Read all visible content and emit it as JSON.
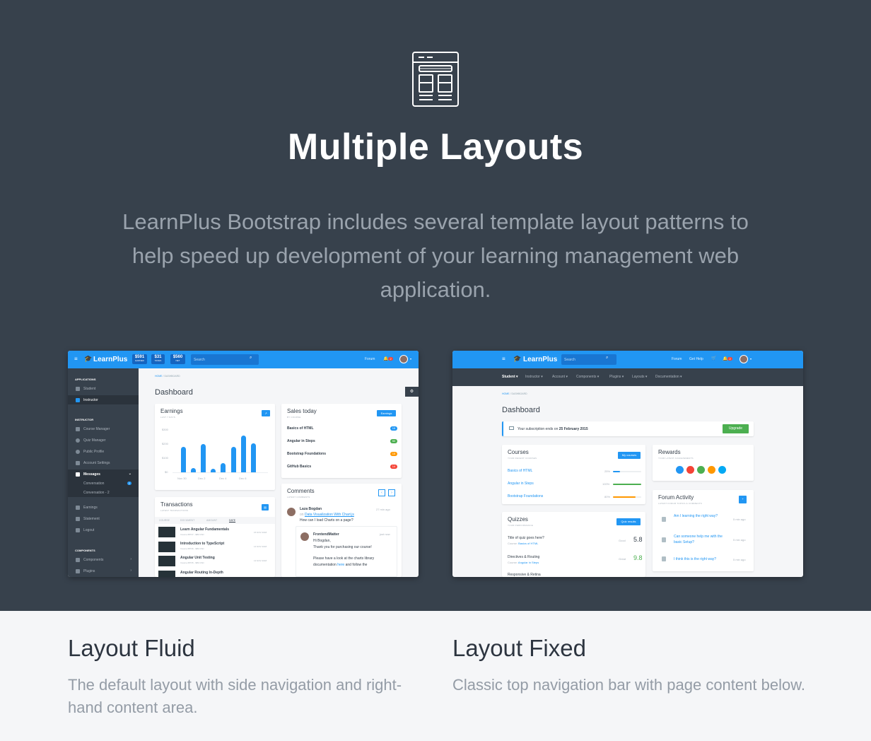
{
  "hero": {
    "icon": "layout-template-icon",
    "title": "Multiple Layouts",
    "description": "LearnPlus Bootstrap includes several template layout patterns to help speed up development of your learning management web application."
  },
  "colors": {
    "hero_bg": "#37414c",
    "accent": "#2196f3",
    "success": "#4caf50",
    "warning": "#ff9800",
    "danger": "#f44336"
  },
  "fluid": {
    "brand": "LearnPlus",
    "stats": [
      {
        "value": "$591",
        "label": "EARNED"
      },
      {
        "value": "$31",
        "label": "TAXES"
      },
      {
        "value": "$560",
        "label": "NET"
      }
    ],
    "search_placeholder": "Search",
    "forum": "Forum",
    "notif_count": "2",
    "sidebar": {
      "applications": "APPLICATIONS",
      "student": "Student",
      "instructor_item": "Instructor",
      "instructor_head": "INSTRUCTOR",
      "course_manager": "Course Manager",
      "quiz_manager": "Quiz Manager",
      "public_profile": "Public Profile",
      "account_settings": "Account Settings",
      "messages": "Messages",
      "conversation": "Conversation",
      "conversation_badge": "2",
      "conversation2": "Conversation - 2",
      "earnings": "Earnings",
      "statement": "Statement",
      "logout": "Logout",
      "components_head": "COMPONENTS",
      "components": "Components",
      "plugins": "Plugins"
    },
    "breadcrumb": {
      "home": "HOME",
      "sep": "/",
      "current": "DASHBOARD"
    },
    "page_title": "Dashboard",
    "earnings": {
      "title": "Earnings",
      "subtitle": "LAST 7 DAYS",
      "y_ticks": [
        "$300",
        "$200",
        "$100",
        "$0"
      ],
      "x_ticks": [
        "Nov 30",
        "Dec 2",
        "Dec 4",
        "Dec 6"
      ]
    },
    "sales": {
      "title": "Sales today",
      "subtitle": "BY COURSE",
      "button": "Earnings",
      "rows": [
        {
          "name": "Basics of HTML",
          "count": "15",
          "color": "#2196f3"
        },
        {
          "name": "Angular in Steps",
          "count": "50",
          "color": "#4caf50"
        },
        {
          "name": "Bootstrap Foundations",
          "count": "15",
          "color": "#ff9800"
        },
        {
          "name": "GitHub Basics",
          "count": "14",
          "color": "#f44336"
        }
      ]
    },
    "transactions": {
      "title": "Transactions",
      "subtitle": "LATEST TRANSACTIONS",
      "headers": [
        "COURSE",
        "DOCUMENT",
        "AMOUNT",
        "DATE"
      ],
      "rows": [
        {
          "name": "Learn Angular Fundamentals",
          "meta": "Invoice #8737 - $89 USD",
          "date": "15 NOV 2018"
        },
        {
          "name": "Introduction to TypeScript",
          "meta": "Invoice #8736 - $89 USD",
          "date": "14 NOV 2018"
        },
        {
          "name": "Angular Unit Testing",
          "meta": "Invoice #8735 - $89 USD",
          "date": "13 NOV 2018"
        },
        {
          "name": "Angular Routing In-Depth",
          "meta": "",
          "date": ""
        }
      ]
    },
    "comments": {
      "title": "Comments",
      "subtitle": "LATEST COMMENTS",
      "c1_name": "Laza Bogdan",
      "c1_on": "on",
      "c1_link": "Data Visualization With Chart.js",
      "c1_text": "How can I load Charts on a page?",
      "c1_time": "27 min ago",
      "c2_name": "FrontendMatter",
      "c2_time": "just now",
      "c2_l1": "Hi Bogdan,",
      "c2_l2": "Thank you for purchasing our course!",
      "c2_l3": "Please have a look at the charts library",
      "c2_l4a": "documentation",
      "c2_l4b": "here",
      "c2_l4c": "and follow the"
    }
  },
  "fixed": {
    "brand": "LearnPlus",
    "search_placeholder": "Search",
    "forum": "Forum",
    "get_help": "Get Help",
    "notif_count": "2",
    "menu": [
      "Student ▾",
      "Instructor ▾",
      "Account ▾",
      "Components ▾",
      "Plugins ▾",
      "Layouts ▾",
      "Documentation ▾"
    ],
    "breadcrumb": {
      "home": "HOME",
      "sep": "/",
      "current": "DASHBOARD"
    },
    "page_title": "Dashboard",
    "alert_prefix": "Your subscription ends on",
    "alert_date": "25 February 2015",
    "upgrade": "Upgrade",
    "courses": {
      "title": "Courses",
      "subtitle": "YOUR RECENT COURSES",
      "button": "My courses",
      "rows": [
        {
          "name": "Basics of HTML",
          "pct": "25%",
          "value": 0.25,
          "color": "#2196f3"
        },
        {
          "name": "Angular in Steps",
          "pct": "100%",
          "value": 1.0,
          "color": "#4caf50"
        },
        {
          "name": "Bootstrap Foundations",
          "pct": "80%",
          "value": 0.8,
          "color": "#ff9800"
        }
      ]
    },
    "rewards": {
      "title": "Rewards",
      "subtitle": "YOUR LATEST ACHIEVEMENTS",
      "colors": [
        "#2196f3",
        "#f44336",
        "#4caf50",
        "#ff9800",
        "#03a9f4"
      ]
    },
    "quizzes": {
      "title": "Quizzes",
      "subtitle": "YOUR PERFORMANCE",
      "button": "Quiz results",
      "rows": [
        {
          "name": "Title of quiz goes here?",
          "course_label": "Course:",
          "course": "Basics of HTML",
          "grade": "Good",
          "score": "5.8",
          "score_color": "#37414c"
        },
        {
          "name": "Directives & Routing",
          "course_label": "Course:",
          "course": "Angular in Steps",
          "grade": "Great",
          "score": "9.8",
          "score_color": "#4caf50"
        },
        {
          "name": "Responsive & Retina",
          "course_label": "",
          "course": "",
          "grade": "",
          "score": "",
          "score_color": "#37414c"
        }
      ]
    },
    "forum_activity": {
      "title": "Forum Activity",
      "subtitle": "LATEST FORUM TOPICS & COMMENTS",
      "rows": [
        {
          "text": "Am I learning the right way?",
          "time": "5 min ago"
        },
        {
          "text": "Can someone help me with the basic Setup?",
          "time": "5 min ago"
        },
        {
          "text": "I think this is the right way?",
          "time": "5 min ago"
        }
      ]
    }
  },
  "captions": {
    "fluid_title": "Layout Fluid",
    "fluid_desc": "The default layout with side navigation and right-hand content area.",
    "fixed_title": "Layout Fixed",
    "fixed_desc": "Classic top navigation bar with page content below."
  }
}
